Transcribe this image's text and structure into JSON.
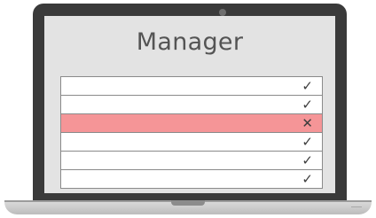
{
  "screen": {
    "title": "Manager"
  },
  "checklist": {
    "rows": [
      {
        "status": "passed",
        "mark": "✓"
      },
      {
        "status": "passed",
        "mark": "✓"
      },
      {
        "status": "failed",
        "mark": "✕"
      },
      {
        "status": "passed",
        "mark": "✓"
      },
      {
        "status": "passed",
        "mark": "✓"
      },
      {
        "status": "passed",
        "mark": "✓"
      }
    ]
  },
  "colors": {
    "failed_row": "#f59597",
    "screen_bg": "#e3e3e3",
    "bezel": "#3a3a3a"
  }
}
